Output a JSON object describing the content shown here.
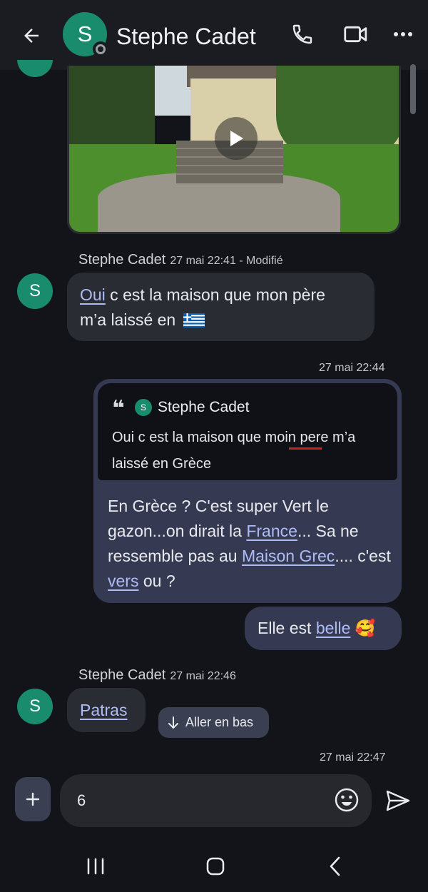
{
  "header": {
    "contact_name": "Stephe Cadet",
    "avatar_letter": "S",
    "icons": [
      "back-arrow-icon",
      "phone-icon",
      "video-call-icon",
      "more-options-icon"
    ]
  },
  "conversation": {
    "msg1": {
      "sender": "Stephe Cadet",
      "time": "27 mai 22:41 - Modifié",
      "avatar_letter": "S",
      "text_link": "Oui",
      "text_rest_1": " c est la maison que mon  père",
      "text_rest_2": "m’a laissé en",
      "flag": "🇬🇷"
    },
    "msg2": {
      "time": "27 mai 22:44",
      "quote_mark": "❝",
      "quote_avatar_letter": "S",
      "quote_sender": "Stephe Cadet",
      "quote_text": "Oui c est la maison que moin pere m’a laissé en Grèce",
      "reply_parts": [
        {
          "t": "En Grèce ? C'est super Vert le gazon...on dirait la ",
          "link": false
        },
        {
          "t": "France",
          "link": true
        },
        {
          "t": "... Sa ne ressemble pas au ",
          "link": false
        },
        {
          "t": "Maison Grec",
          "link": true
        },
        {
          "t": ".... c'est ",
          "link": false
        },
        {
          "t": "vers",
          "link": true
        },
        {
          "t": " ou  ?",
          "link": false
        }
      ]
    },
    "msg3": {
      "text_plain": "Elle est ",
      "text_link": "belle",
      "emoji": "🥰"
    },
    "msg4": {
      "sender": "Stephe Cadet",
      "time": "27 mai 22:46",
      "avatar_letter": "S",
      "text_link": "Patras"
    },
    "jump_button": "Aller en bas",
    "last_time": "27 mai 22:47"
  },
  "composer": {
    "input_value": "6",
    "icons": [
      "add-icon",
      "emoji-icon",
      "send-icon"
    ]
  },
  "colors": {
    "background": "#13141a",
    "avatar": "#1a8c6e",
    "incoming_bubble": "#2a2c33",
    "outgoing_bubble": "#353a52",
    "link": "#aebcf5"
  }
}
